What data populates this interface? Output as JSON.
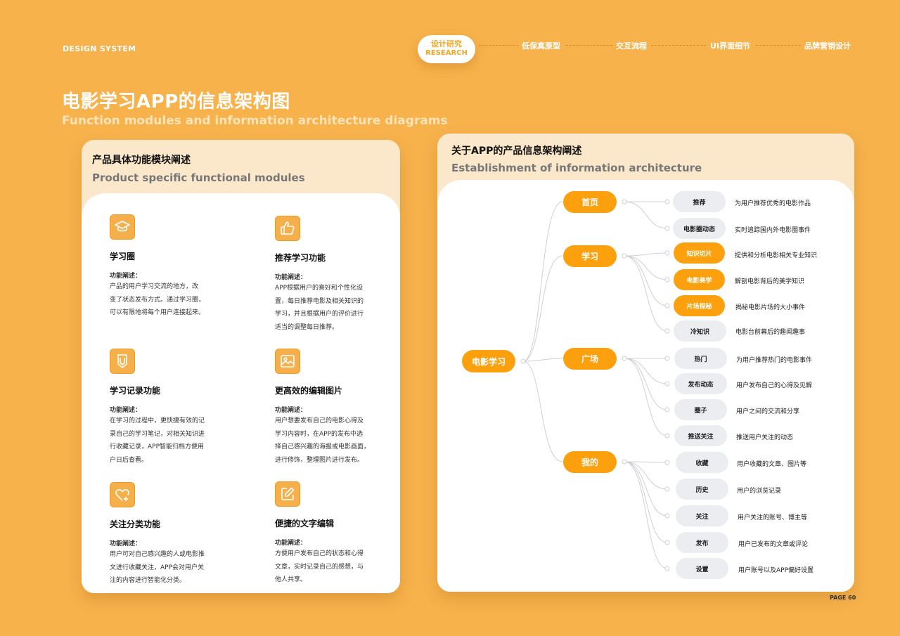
{
  "brand": "DESIGN SYSTEM",
  "nav": {
    "active_cn": "设计研究",
    "active_en": "RESEARCH",
    "items": [
      "低保真原型",
      "交互流程",
      "UI界面细节",
      "品牌营销设计"
    ]
  },
  "title": {
    "cn": "电影学习APP的信息架构图",
    "en": "Function modules and information architecture diagrams"
  },
  "left_panel": {
    "header_cn": "产品具体功能模块阐述",
    "header_en": "Product specific functional modules",
    "features": [
      {
        "name": "学习圈",
        "icon": "graduation-cap-icon",
        "label": "功能阐述：",
        "lines": [
          "产品的用户学习交流的地方，改",
          "变了状态发布方式。通过学习圈，",
          "可以有限地将每个用户连接起来。"
        ]
      },
      {
        "name": "推荐学习功能",
        "icon": "thumbs-up-icon",
        "label": "功能阐述：",
        "lines": [
          "APP根据用户的喜好和个性化设",
          "置，每日推荐电影及相关知识的",
          "学习，并且根据用户的评价进行",
          "适当的调整每日推荐。"
        ]
      },
      {
        "name": "学习记录功能",
        "icon": "pencil-record-icon",
        "label": "功能阐述：",
        "lines": [
          "在学习的过程中，更快捷有效的记",
          "录自己的学习笔记，对相关知识进",
          "行收藏记录，APP智能归档方便用",
          "户日后查看。"
        ]
      },
      {
        "name": "更高效的编辑图片",
        "icon": "image-icon",
        "label": "功能阐述：",
        "lines": [
          "用户想要发布自己的电影心得及",
          "学习内容时，在APP的发布中选",
          "择自己感兴趣的海报或电影画面，",
          "进行修饰，整理图片进行发布。"
        ]
      },
      {
        "name": "关注分类功能",
        "icon": "heart-plus-icon",
        "label": "功能阐述：",
        "lines": [
          "用户可对自己感兴趣的人或电影推",
          "文进行收藏关注，APP会对用户关",
          "注的内容进行智能化分类。"
        ]
      },
      {
        "name": "便捷的文字编辑",
        "icon": "edit-icon",
        "label": "功能阐述：",
        "lines": [
          "方便用户发布自己的状态和心得",
          "文章，实时记录自己的感想，与",
          "他人共享。"
        ]
      }
    ]
  },
  "right_panel": {
    "header_cn": "关于APP的产品信息架构阐述",
    "header_en": "Establishment of information architecture",
    "root": "电影学习",
    "branches": [
      "首页",
      "学习",
      "广场",
      "我的"
    ],
    "leaves": [
      {
        "name": "推荐",
        "desc": "为用户推荐优秀的电影作品",
        "style": "gray"
      },
      {
        "name": "电影圈动态",
        "desc": "实时追踪国内外电影圈事件",
        "style": "gray"
      },
      {
        "name": "知识切片",
        "desc": "提供和分析电影相关专业知识",
        "style": "orange"
      },
      {
        "name": "电影美学",
        "desc": "解剖电影背后的美学知识",
        "style": "orange"
      },
      {
        "name": "片场探秘",
        "desc": "揭秘电影片场的大小事件",
        "style": "orange"
      },
      {
        "name": "冷知识",
        "desc": "电影台前幕后的趣闻趣事",
        "style": "gray"
      },
      {
        "name": "热门",
        "desc": "为用户推荐热门的电影事件",
        "style": "gray"
      },
      {
        "name": "发布动态",
        "desc": "用户发布自己的心得及见解",
        "style": "gray"
      },
      {
        "name": "圈子",
        "desc": "用户之间的交流和分享",
        "style": "gray"
      },
      {
        "name": "推送关注",
        "desc": "推送用户关注的动态",
        "style": "gray"
      },
      {
        "name": "收藏",
        "desc": "用户收藏的文章、图片等",
        "style": "gray"
      },
      {
        "name": "历史",
        "desc": "用户的浏览记录",
        "style": "gray"
      },
      {
        "name": "关注",
        "desc": "用户关注的账号、博主等",
        "style": "gray"
      },
      {
        "name": "发布",
        "desc": "用户已发布的文章或评论",
        "style": "gray"
      },
      {
        "name": "设置",
        "desc": "用户账号以及APP偏好设置",
        "style": "gray"
      }
    ]
  },
  "page_number": "PAGE 60",
  "colors": {
    "background": "#F7B24C",
    "accent": "#FCA10D",
    "panel_header": "#FBE7C9"
  }
}
